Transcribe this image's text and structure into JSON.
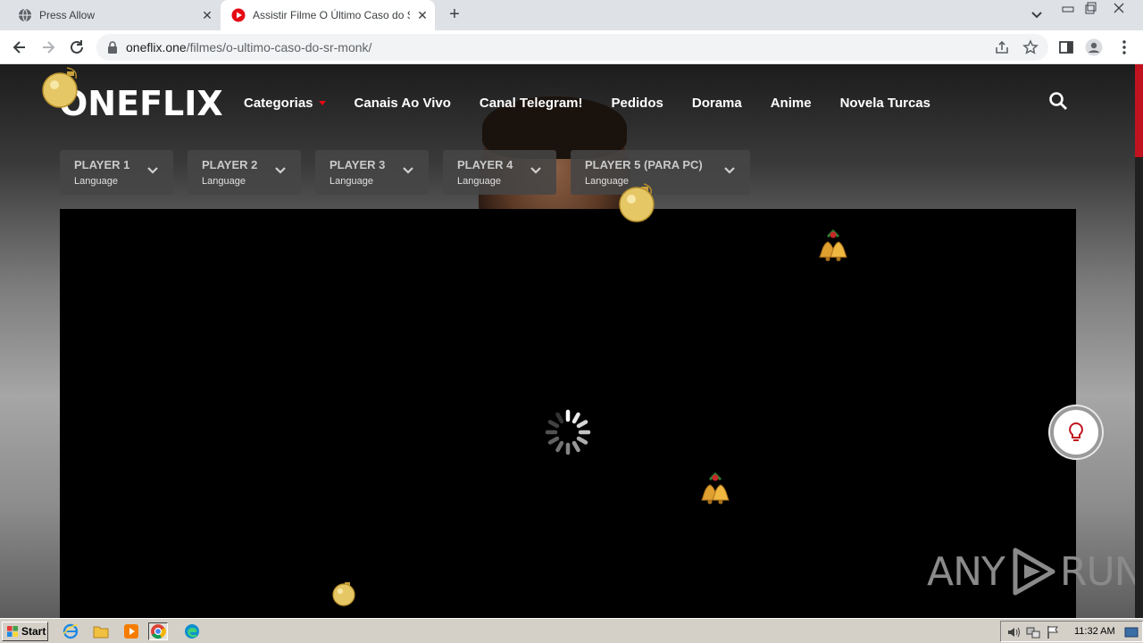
{
  "browser": {
    "tabs": [
      {
        "title": "Press Allow",
        "favicon": "globe-icon",
        "active": false
      },
      {
        "title": "Assistir Filme O Último Caso do Sr. Monk",
        "favicon": "play-icon",
        "active": true
      }
    ],
    "url_host": "oneflix.one",
    "url_path": "/filmes/o-ultimo-caso-do-sr-monk/"
  },
  "site": {
    "logo": "ONEFLIX",
    "nav": [
      {
        "label": "Categorias",
        "has_dropdown": true
      },
      {
        "label": "Canais Ao Vivo"
      },
      {
        "label": "Canal Telegram!"
      },
      {
        "label": "Pedidos"
      },
      {
        "label": "Dorama"
      },
      {
        "label": "Anime"
      },
      {
        "label": "Novela Turcas"
      }
    ],
    "players": [
      {
        "name": "PLAYER 1",
        "sub": "Language"
      },
      {
        "name": "PLAYER 2",
        "sub": "Language"
      },
      {
        "name": "PLAYER 3",
        "sub": "Language"
      },
      {
        "name": "PLAYER 4",
        "sub": "Language"
      },
      {
        "name": "PLAYER 5 (PARA PC)",
        "sub": "Language"
      }
    ],
    "accent_color": "#e50914"
  },
  "watermark": {
    "left": "ANY",
    "right": "RUN"
  },
  "taskbar": {
    "start_label": "Start",
    "apps": [
      "ie-icon",
      "explorer-icon",
      "media-player-icon",
      "chrome-icon",
      "edge-icon"
    ],
    "clock": "11:32 AM"
  }
}
